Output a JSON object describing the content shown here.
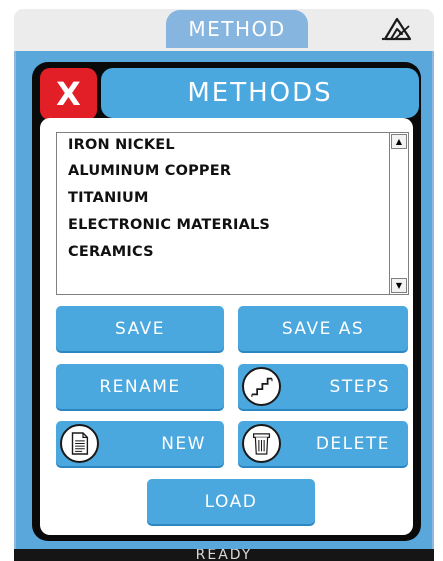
{
  "header": {
    "tab_label": "METHOD",
    "title": "METHODS",
    "close_label": "X"
  },
  "method_list": {
    "items": [
      "IRON NICKEL",
      "ALUMINUM COPPER",
      "TITANIUM",
      "ELECTRONIC MATERIALS",
      "CERAMICS"
    ]
  },
  "buttons": {
    "save": "SAVE",
    "save_as": "SAVE AS",
    "rename": "RENAME",
    "steps": "STEPS",
    "new": "NEW",
    "delete": "DELETE",
    "load": "LOAD"
  },
  "icons": {
    "logo": "brand-logo-icon",
    "close": "close-icon",
    "steps": "stairs-icon",
    "new": "document-icon",
    "delete": "trash-can-icon",
    "scroll_up": "scroll-up-arrow-icon",
    "scroll_down": "scroll-down-arrow-icon"
  },
  "status": {
    "text": "READY"
  },
  "colors": {
    "accent_blue": "#4aa8df",
    "tab_blue": "#86b5e0",
    "close_red": "#e21e26",
    "panel_black": "#0a0a0a"
  }
}
